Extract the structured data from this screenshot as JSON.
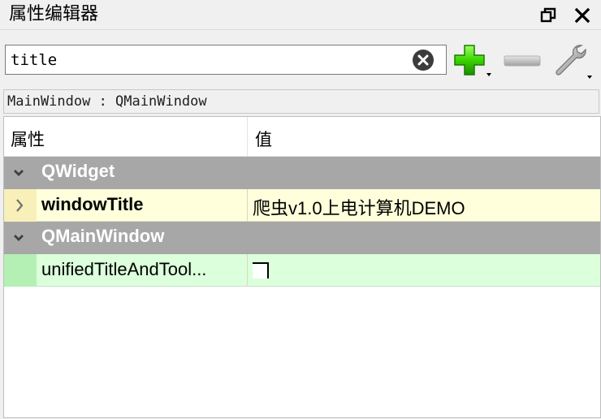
{
  "panel": {
    "title": "属性编辑器"
  },
  "filter": {
    "value": "title"
  },
  "class_label": "MainWindow : QMainWindow",
  "table": {
    "headers": {
      "property": "属性",
      "value": "值"
    },
    "groups": [
      {
        "name": "QWidget",
        "rows": [
          {
            "name": "windowTitle",
            "value": "爬虫v1.0上电计算机DEMO",
            "modified": true
          }
        ]
      },
      {
        "name": "QMainWindow",
        "rows": [
          {
            "name": "unifiedTitleAndTool...",
            "value_type": "checkbox",
            "checked": false
          }
        ]
      }
    ]
  },
  "colors": {
    "group_bg": "#a7a7a7",
    "row_yellow": "#ffffdc",
    "row_green": "#dcffdc",
    "add_icon": "#33cc00"
  },
  "icons": {
    "float": "float-icon",
    "close": "close-icon",
    "clear": "clear-icon",
    "add": "add-icon",
    "remove": "remove-icon",
    "configure": "wrench-icon"
  }
}
